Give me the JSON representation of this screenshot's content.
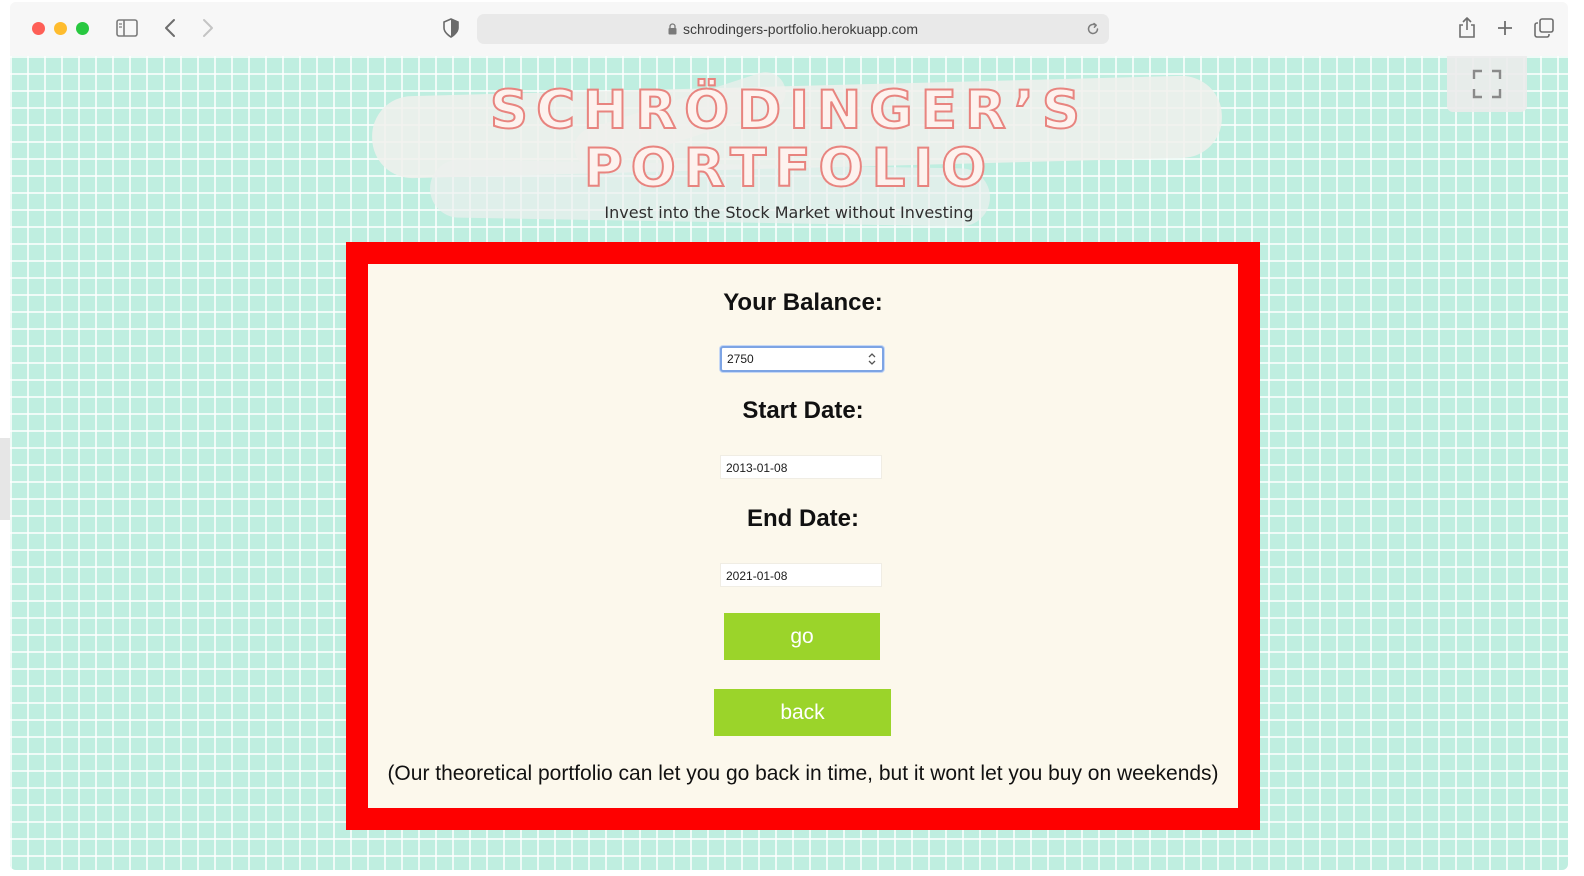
{
  "browser": {
    "url": "schrodingers-portfolio.herokuapp.com",
    "icons": {
      "sidebar": "sidebar-icon",
      "back": "chevron-left-icon",
      "forward": "chevron-right-icon",
      "privacy": "shield-icon",
      "lock": "lock-icon",
      "reload": "reload-icon",
      "share": "share-icon",
      "new_tab": "plus-icon",
      "tabs": "tabs-overview-icon",
      "fullscreen": "fullscreen-icon"
    }
  },
  "page": {
    "title_line1": "SCHRÖDINGER’S",
    "title_line2": "PORTFOLIO",
    "subtitle": "Invest into the Stock Market without Investing",
    "colors": {
      "background": "#bfeee0",
      "card_border": "#fe0000",
      "card_background": "#fcf8ec",
      "button": "#9bd42a",
      "title_outline": "#e8847f"
    }
  },
  "form": {
    "balance_label": "Your Balance:",
    "balance_value": "2750",
    "start_label": "Start Date:",
    "start_value": "2013-01-08",
    "end_label": "End Date:",
    "end_value": "2021-01-08",
    "go_label": "go",
    "back_label": "back",
    "note": "(Our theoretical portfolio can let you go back in time, but it wont let you buy on weekends)"
  }
}
